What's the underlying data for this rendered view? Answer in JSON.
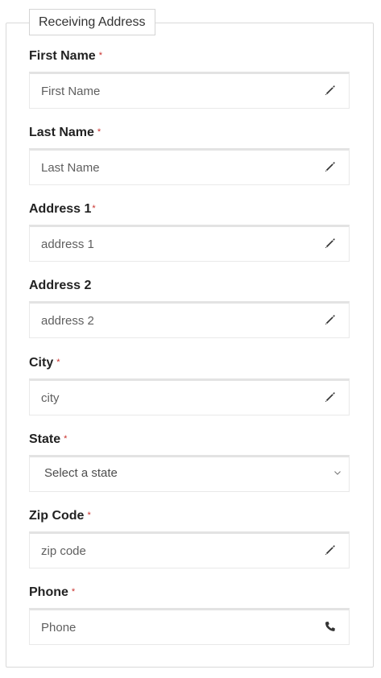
{
  "form": {
    "legend": "Receiving Address",
    "fields": {
      "first_name": {
        "label": "First Name",
        "required_mark": "*",
        "placeholder": "First Name",
        "icon": "pencil-icon"
      },
      "last_name": {
        "label": "Last Name",
        "required_mark": "*",
        "placeholder": "Last Name",
        "icon": "pencil-icon"
      },
      "address1": {
        "label": "Address 1",
        "required_mark": "*",
        "placeholder": "address 1",
        "icon": "pencil-icon"
      },
      "address2": {
        "label": "Address 2",
        "placeholder": "address 2",
        "icon": "pencil-icon"
      },
      "city": {
        "label": "City",
        "required_mark": "*",
        "placeholder": "city",
        "icon": "pencil-icon"
      },
      "state": {
        "label": "State",
        "required_mark": "*",
        "selected": "Select a state",
        "icon": "chevron-down-icon"
      },
      "zip": {
        "label": "Zip Code",
        "required_mark": "*",
        "placeholder": "zip code",
        "icon": "pencil-icon"
      },
      "phone": {
        "label": "Phone",
        "required_mark": "*",
        "placeholder": "Phone",
        "icon": "phone-icon"
      }
    }
  },
  "colors": {
    "required": "#c9302c",
    "border": "#d9d9d9",
    "label": "#222222"
  }
}
